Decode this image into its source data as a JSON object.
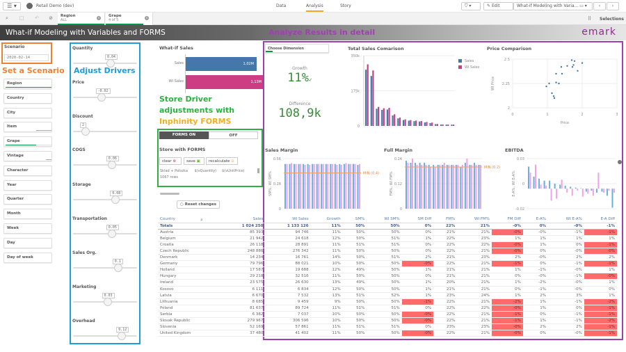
{
  "app": {
    "title": "Retail Demo (dev)",
    "nav_tabs": [
      "Data",
      "Analysis",
      "Story"
    ],
    "active_tab": "Analysis",
    "edit_label": "Edit",
    "sheet_selector": "What-if Modeling with Varia...",
    "selections_label": "Selections"
  },
  "selections": [
    {
      "field": "Region",
      "value": "ALL"
    },
    {
      "field": "Grape",
      "value": "4 of 5"
    }
  ],
  "sheet": {
    "title": "What-if Modeling with Variables and FORMS",
    "logo": "emark"
  },
  "annotations": {
    "scenario": "Set a Scenario",
    "drivers": "Adjust Drivers",
    "forms_line1": "Store Driver",
    "forms_line2": "adjustments with",
    "forms_line3": "Inphinity FORMS",
    "analyze": "Analyze Results in detail"
  },
  "scenario": {
    "label": "Scenario",
    "value": "2020-02-14"
  },
  "filters": [
    {
      "label": "Region",
      "bar": "full"
    },
    {
      "label": "Country"
    },
    {
      "label": "City"
    },
    {
      "label": "Item",
      "bar": "grey"
    },
    {
      "label": "Grape",
      "bar": "partial"
    },
    {
      "label": "Vintage",
      "bar": "greysmall"
    },
    {
      "label": "Character"
    },
    {
      "label": "Year"
    },
    {
      "label": "Quarter"
    },
    {
      "label": "Month"
    },
    {
      "label": "Week"
    },
    {
      "label": "Day"
    },
    {
      "label": "Day of week"
    }
  ],
  "drivers": [
    {
      "label": "Quantity",
      "value": "0.04",
      "pos": 0.6
    },
    {
      "label": "Price",
      "value": "-0.02",
      "pos": 0.45
    },
    {
      "label": "Discount",
      "value": "2",
      "pos": 0.2
    },
    {
      "label": "COGS",
      "value": "0.06",
      "pos": 0.62
    },
    {
      "label": "Storage",
      "value": "0.08",
      "pos": 0.68
    },
    {
      "label": "Transportation",
      "value": "0.05",
      "pos": 0.62
    },
    {
      "label": "Sales Org.",
      "value": "0.1",
      "pos": 0.72
    },
    {
      "label": "Marketing",
      "value": "0.03",
      "pos": 0.55
    },
    {
      "label": "Overhead",
      "value": "0.12",
      "pos": 0.78
    }
  ],
  "whatif": {
    "title": "What-if Sales",
    "bars": [
      {
        "label": "Sales",
        "value_label": "1,02M",
        "value": 1.02,
        "color": "#4477aa"
      },
      {
        "label": "WI Sales",
        "value_label": "1,13M",
        "value": 1.13,
        "color": "#cc3d84"
      }
    ]
  },
  "forms": {
    "on_label": "FORMS ON",
    "off_label": "OFF",
    "title": "Store with FORMS",
    "clear": "clear",
    "save": "save",
    "recalculate": "recalculate",
    "columns": [
      "Sklad + Polozka",
      "$(vQuantity)",
      "$(vUnitPrice)"
    ],
    "rows_count": "1067 rows"
  },
  "reset_label": "Reset changes",
  "kpi": {
    "dimension_label": "Choose Dimension",
    "growth_label": "Growth",
    "growth_value": "11%",
    "difference_label": "Difference",
    "difference_value": "108,9k"
  },
  "chart_data": [
    {
      "type": "bar",
      "title": "Total Sales Comarison",
      "ylim": [
        0,
        350000
      ],
      "yticks": [
        "0",
        "175k",
        "350k"
      ],
      "legend": [
        "Sales",
        "WI Sales"
      ],
      "legend_position": "right",
      "series": [
        {
          "name": "Sales",
          "color": "#4477aa",
          "values": [
            279967,
            248886,
            85393,
            79796,
            81637,
            52169,
            37480,
            29218,
            26118,
            23575,
            21942,
            17587,
            14234,
            8685,
            6670,
            6382,
            6111
          ]
        },
        {
          "name": "WI Sales",
          "color": "#cc3d84",
          "values": [
            306596,
            276342,
            94746,
            88021,
            89724,
            57861,
            41402,
            32516,
            28891,
            26630,
            24618,
            19688,
            16761,
            9459,
            7532,
            7037,
            6834
          ]
        }
      ]
    },
    {
      "type": "scatter",
      "title": "Price Comparison",
      "xlabel": "Price",
      "ylabel": "WI Price",
      "xlim": [
        0,
        3
      ],
      "ylim": [
        2,
        2.5
      ],
      "xticks": [
        "0",
        "1",
        "2",
        "3"
      ],
      "yticks": [
        "2",
        "2.25",
        "2.5"
      ],
      "points": [
        [
          0.97,
          2.22
        ],
        [
          1.05,
          2.25
        ],
        [
          1.13,
          2.15
        ],
        [
          1.18,
          2.12
        ],
        [
          1.2,
          2.1
        ],
        [
          1.25,
          2.26
        ],
        [
          1.33,
          2.25
        ],
        [
          1.25,
          2.35
        ],
        [
          1.4,
          2.42
        ],
        [
          1.42,
          2.35
        ],
        [
          1.57,
          2.43
        ],
        [
          1.7,
          2.49
        ],
        [
          1.72,
          2.42
        ],
        [
          1.75,
          2.44
        ],
        [
          1.78,
          2.48
        ],
        [
          1.87,
          2.38
        ],
        [
          2.0,
          2.46
        ]
      ]
    },
    {
      "type": "bar",
      "title": "Sales Margin",
      "ylabel": "SM%, WI SM%",
      "ylim": [
        0,
        0.56
      ],
      "yticks": [
        "0",
        "0.28",
        "0.56"
      ],
      "reference": {
        "label": "MIN (0.4)",
        "value": 0.4
      },
      "series": [
        {
          "name": "SM%",
          "values": [
            0.5,
            0.5,
            0.5,
            0.5,
            0.5,
            0.5,
            0.5,
            0.5,
            0.5,
            0.5,
            0.5,
            0.5,
            0.5,
            0.5,
            0.5,
            0.5,
            0.49
          ]
        },
        {
          "name": "WI SM%",
          "values": [
            0.5,
            0.51,
            0.5,
            0.5,
            0.49,
            0.49,
            0.5,
            0.5,
            0.5,
            0.5,
            0.5,
            0.49,
            0.49,
            0.51,
            0.5,
            0.5,
            0.5
          ]
        }
      ]
    },
    {
      "type": "bar",
      "title": "Full Margin",
      "ylabel": "FM%, WI FM%",
      "ylim": [
        0,
        0.24
      ],
      "yticks": [
        "0",
        "0.12",
        "0.24"
      ],
      "reference": {
        "label": "MIN (0.2)",
        "value": 0.2
      },
      "series": [
        {
          "name": "FM%",
          "values": [
            0.23,
            0.22,
            0.22,
            0.22,
            0.22,
            0.21,
            0.21,
            0.21,
            0.21,
            0.21,
            0.21,
            0.21,
            0.2,
            0.22,
            0.21,
            0.22,
            0.21
          ]
        },
        {
          "name": "WI FM%",
          "values": [
            0.22,
            0.24,
            0.21,
            0.21,
            0.21,
            0.2,
            0.2,
            0.21,
            0.22,
            0.21,
            0.21,
            0.21,
            0.21,
            0.24,
            0.21,
            0.21,
            0.21
          ]
        }
      ]
    },
    {
      "type": "bar",
      "title": "EBITDA",
      "ylabel": "E-A%, WI E-A%",
      "ylim": [
        -0.02,
        0.03
      ],
      "yticks": [
        "-0.02",
        "0",
        "0.03"
      ],
      "series": [
        {
          "name": "E-A%",
          "values": [
            0.022,
            0.012,
            0.01,
            0.008,
            0.008,
            0.005,
            0.004,
            0.003,
            0.002,
            0.001,
            0.0005,
            -0.003,
            -0.002,
            -0.004,
            -0.003,
            -0.007,
            -0.019
          ]
        },
        {
          "name": "WI E-A%",
          "values": [
            0.016,
            0.024,
            0.004,
            0.003,
            -0.012,
            -0.01,
            0.009,
            -0.004,
            -0.007,
            -0.002,
            -0.008,
            -0.005,
            -0.007,
            0.016,
            -0.004,
            -0.002,
            -0.004
          ]
        }
      ]
    }
  ],
  "table": {
    "columns": [
      "Country",
      "Sales",
      "WI Sales",
      "Growth",
      "SM%",
      "WI SM%",
      "SM Diff",
      "FM%",
      "WI FM%",
      "FM Diff",
      "E-A%",
      "WI E-A%",
      "E-A Diff"
    ],
    "totals": [
      "Totals",
      "1 024 250",
      "1 133 126",
      "11%",
      "50%",
      "50%",
      "0%",
      "22%",
      "21%",
      "-0%",
      "0%",
      "-0%",
      "-1%"
    ],
    "rows": [
      [
        "Austria",
        "85 393",
        "94 746",
        "11%",
        "50%",
        "50%",
        "0%",
        "21%",
        "21%",
        "-0%",
        "-0%",
        "-1%",
        "-1%"
      ],
      [
        "Belgium",
        "21 942",
        "24 618",
        "12%",
        "50%",
        "51%",
        "1%",
        "22%",
        "23%",
        "1%",
        "1%",
        "1%",
        "1%"
      ],
      [
        "Croatia",
        "26 118",
        "28 891",
        "11%",
        "51%",
        "51%",
        "0%",
        "22%",
        "22%",
        "-0%",
        "1%",
        "0%",
        "-1%"
      ],
      [
        "Czech Republic",
        "248 886",
        "276 342",
        "11%",
        "50%",
        "50%",
        "0%",
        "22%",
        "21%",
        "-0%",
        "0%",
        "-0%",
        "-0%"
      ],
      [
        "Denmark",
        "14 234",
        "16 761",
        "14%",
        "50%",
        "51%",
        "2%",
        "21%",
        "23%",
        "2%",
        "-0%",
        "2%",
        "2%"
      ],
      [
        "Germany",
        "79 796",
        "88 021",
        "10%",
        "50%",
        "50%",
        "-0%",
        "22%",
        "21%",
        "-1%",
        "0%",
        "-1%",
        "-1%"
      ],
      [
        "Holland",
        "17 587",
        "19 688",
        "12%",
        "49%",
        "50%",
        "1%",
        "21%",
        "21%",
        "1%",
        "-1%",
        "-0%",
        "1%"
      ],
      [
        "Hungary",
        "29 218",
        "32 516",
        "11%",
        "50%",
        "50%",
        "0%",
        "21%",
        "21%",
        "0%",
        "-0%",
        "-1%",
        "-0%"
      ],
      [
        "Ireland",
        "23 575",
        "26 630",
        "13%",
        "49%",
        "50%",
        "1%",
        "20%",
        "21%",
        "1%",
        "-2%",
        "-0%",
        "1%"
      ],
      [
        "Kosovo",
        "6 111",
        "6 834",
        "12%",
        "50%",
        "50%",
        "1%",
        "21%",
        "21%",
        "0%",
        "-1%",
        "-0%",
        "0%"
      ],
      [
        "Latvia",
        "6 670",
        "7 532",
        "13%",
        "51%",
        "52%",
        "1%",
        "23%",
        "24%",
        "1%",
        "2%",
        "3%",
        "1%"
      ],
      [
        "Lithuania",
        "8 685",
        "9 459",
        "9%",
        "50%",
        "50%",
        "-1%",
        "22%",
        "21%",
        "-2%",
        "1%",
        "-1%",
        "-2%"
      ],
      [
        "Poland",
        "81 637",
        "89 724",
        "11%",
        "51%",
        "51%",
        "0%",
        "22%",
        "22%",
        "-0%",
        "1%",
        "0%",
        "-1%"
      ],
      [
        "Serbia",
        "6 382",
        "7 037",
        "10%",
        "50%",
        "50%",
        "-0%",
        "22%",
        "21%",
        "-1%",
        "0%",
        "-1%",
        "-1%"
      ],
      [
        "Slovak Republic",
        "279 967",
        "306 596",
        "10%",
        "50%",
        "50%",
        "-0%",
        "22%",
        "21%",
        "-1%",
        "1%",
        "-1%",
        "-2%"
      ],
      [
        "Slovenia",
        "52 169",
        "57 861",
        "11%",
        "51%",
        "51%",
        "0%",
        "23%",
        "23%",
        "-0%",
        "2%",
        "2%",
        "-1%"
      ],
      [
        "United Kingdom",
        "37 480",
        "41 402",
        "11%",
        "50%",
        "50%",
        "-0%",
        "22%",
        "21%",
        "-0%",
        "0%",
        "-0%",
        "-1%"
      ]
    ],
    "red_cells": [
      [
        0,
        9
      ],
      [
        0,
        12
      ],
      [
        2,
        9
      ],
      [
        2,
        12
      ],
      [
        3,
        9
      ],
      [
        3,
        12
      ],
      [
        5,
        6
      ],
      [
        5,
        9
      ],
      [
        5,
        12
      ],
      [
        7,
        12
      ],
      [
        11,
        6
      ],
      [
        11,
        9
      ],
      [
        11,
        12
      ],
      [
        12,
        9
      ],
      [
        12,
        12
      ],
      [
        13,
        6
      ],
      [
        13,
        9
      ],
      [
        13,
        12
      ],
      [
        14,
        6
      ],
      [
        14,
        9
      ],
      [
        14,
        12
      ],
      [
        15,
        9
      ],
      [
        15,
        12
      ],
      [
        16,
        6
      ],
      [
        16,
        9
      ],
      [
        16,
        12
      ]
    ]
  }
}
